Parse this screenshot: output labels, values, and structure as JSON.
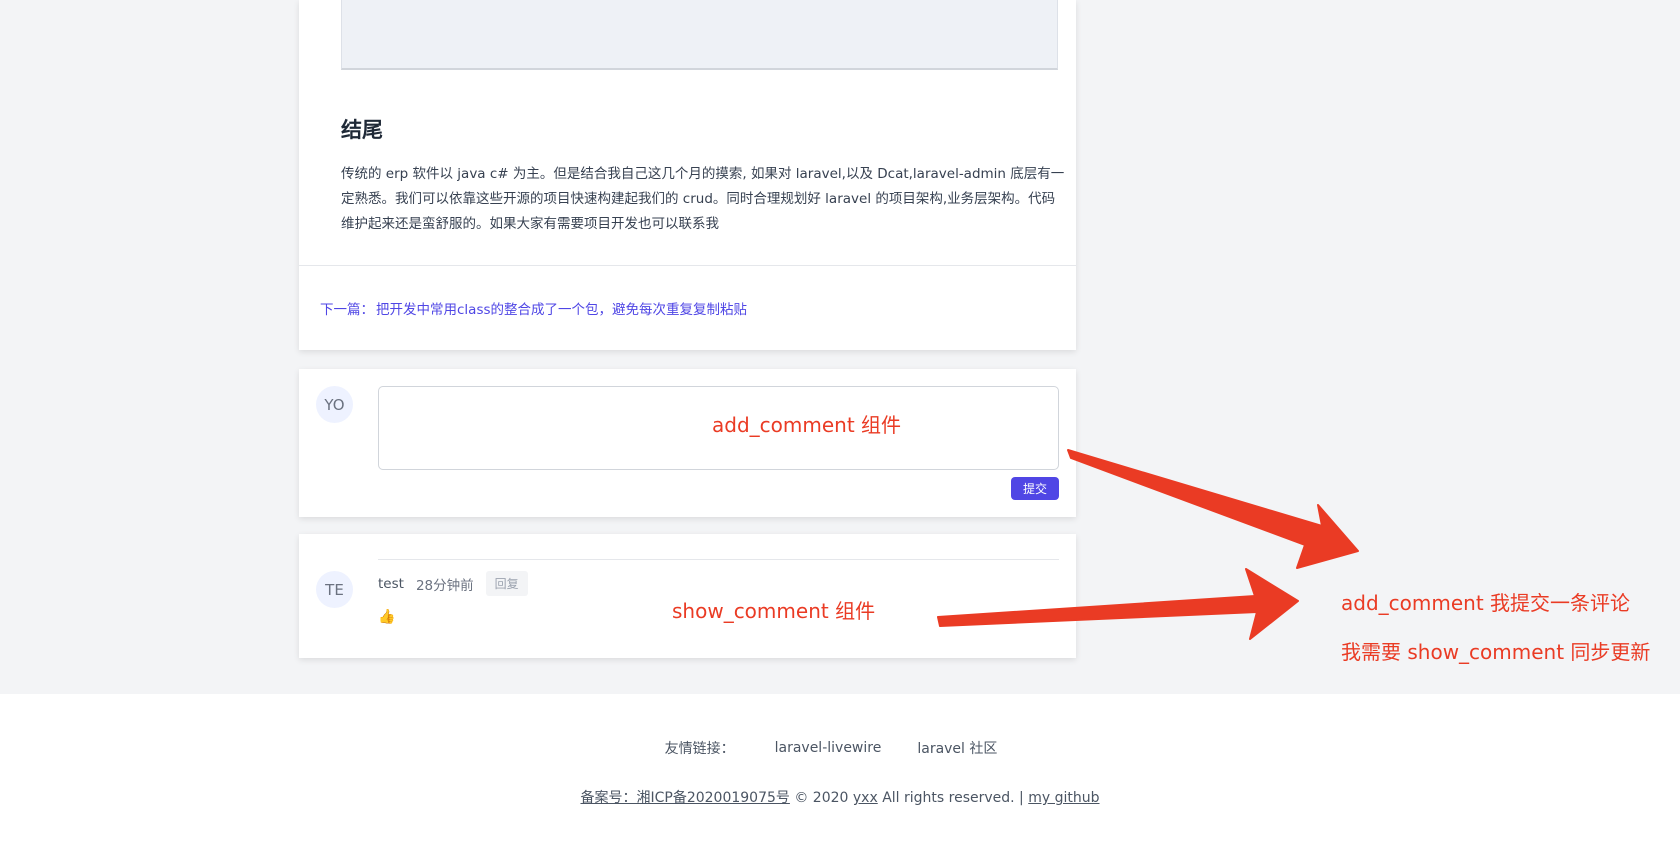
{
  "article": {
    "section_heading": "结尾",
    "paragraph": "传统的 erp 软件以 java c# 为主。但是结合我自己这几个月的摸索, 如果对 laravel,以及 Dcat,laravel-admin 底层有一定熟悉。我们可以依靠这些开源的项目快速构建起我们的 crud。同时合理规划好 laravel 的项目架构,业务层架构。代码维护起来还是蛮舒服的。如果大家有需要项目开发也可以联系我",
    "next_prefix": "下一篇：",
    "next_title": "把开发中常用class的整合成了一个包，避免每次重复复制粘贴"
  },
  "comment_form": {
    "avatar_initials": "YO",
    "textarea_value": "",
    "submit_label": "提交"
  },
  "comments": [
    {
      "avatar_initials": "TE",
      "author": "test",
      "time": "28分钟前",
      "reply_label": "回复",
      "body": "👍"
    }
  ],
  "annotations": {
    "add_comment_label": "add_comment 组件",
    "show_comment_label": "show_comment 组件",
    "note_line1": "add_comment 我提交一条评论",
    "note_line2": "我需要 show_comment 同步更新",
    "color": "#ea3b24"
  },
  "footer": {
    "friend_links_label": "友情链接：",
    "friend_links": [
      "laravel-livewire",
      "laravel 社区"
    ],
    "icp_link": "备案号：湘ICP备2020019075号",
    "copyright_mid": " © 2020 ",
    "author_link": "yxx",
    "rights": " All rights reserved. | ",
    "github_link": "my github"
  },
  "colors": {
    "background": "#f3f4f6",
    "accent": "#5046e5",
    "link": "#4f46e5",
    "annotation": "#ea3b24"
  }
}
